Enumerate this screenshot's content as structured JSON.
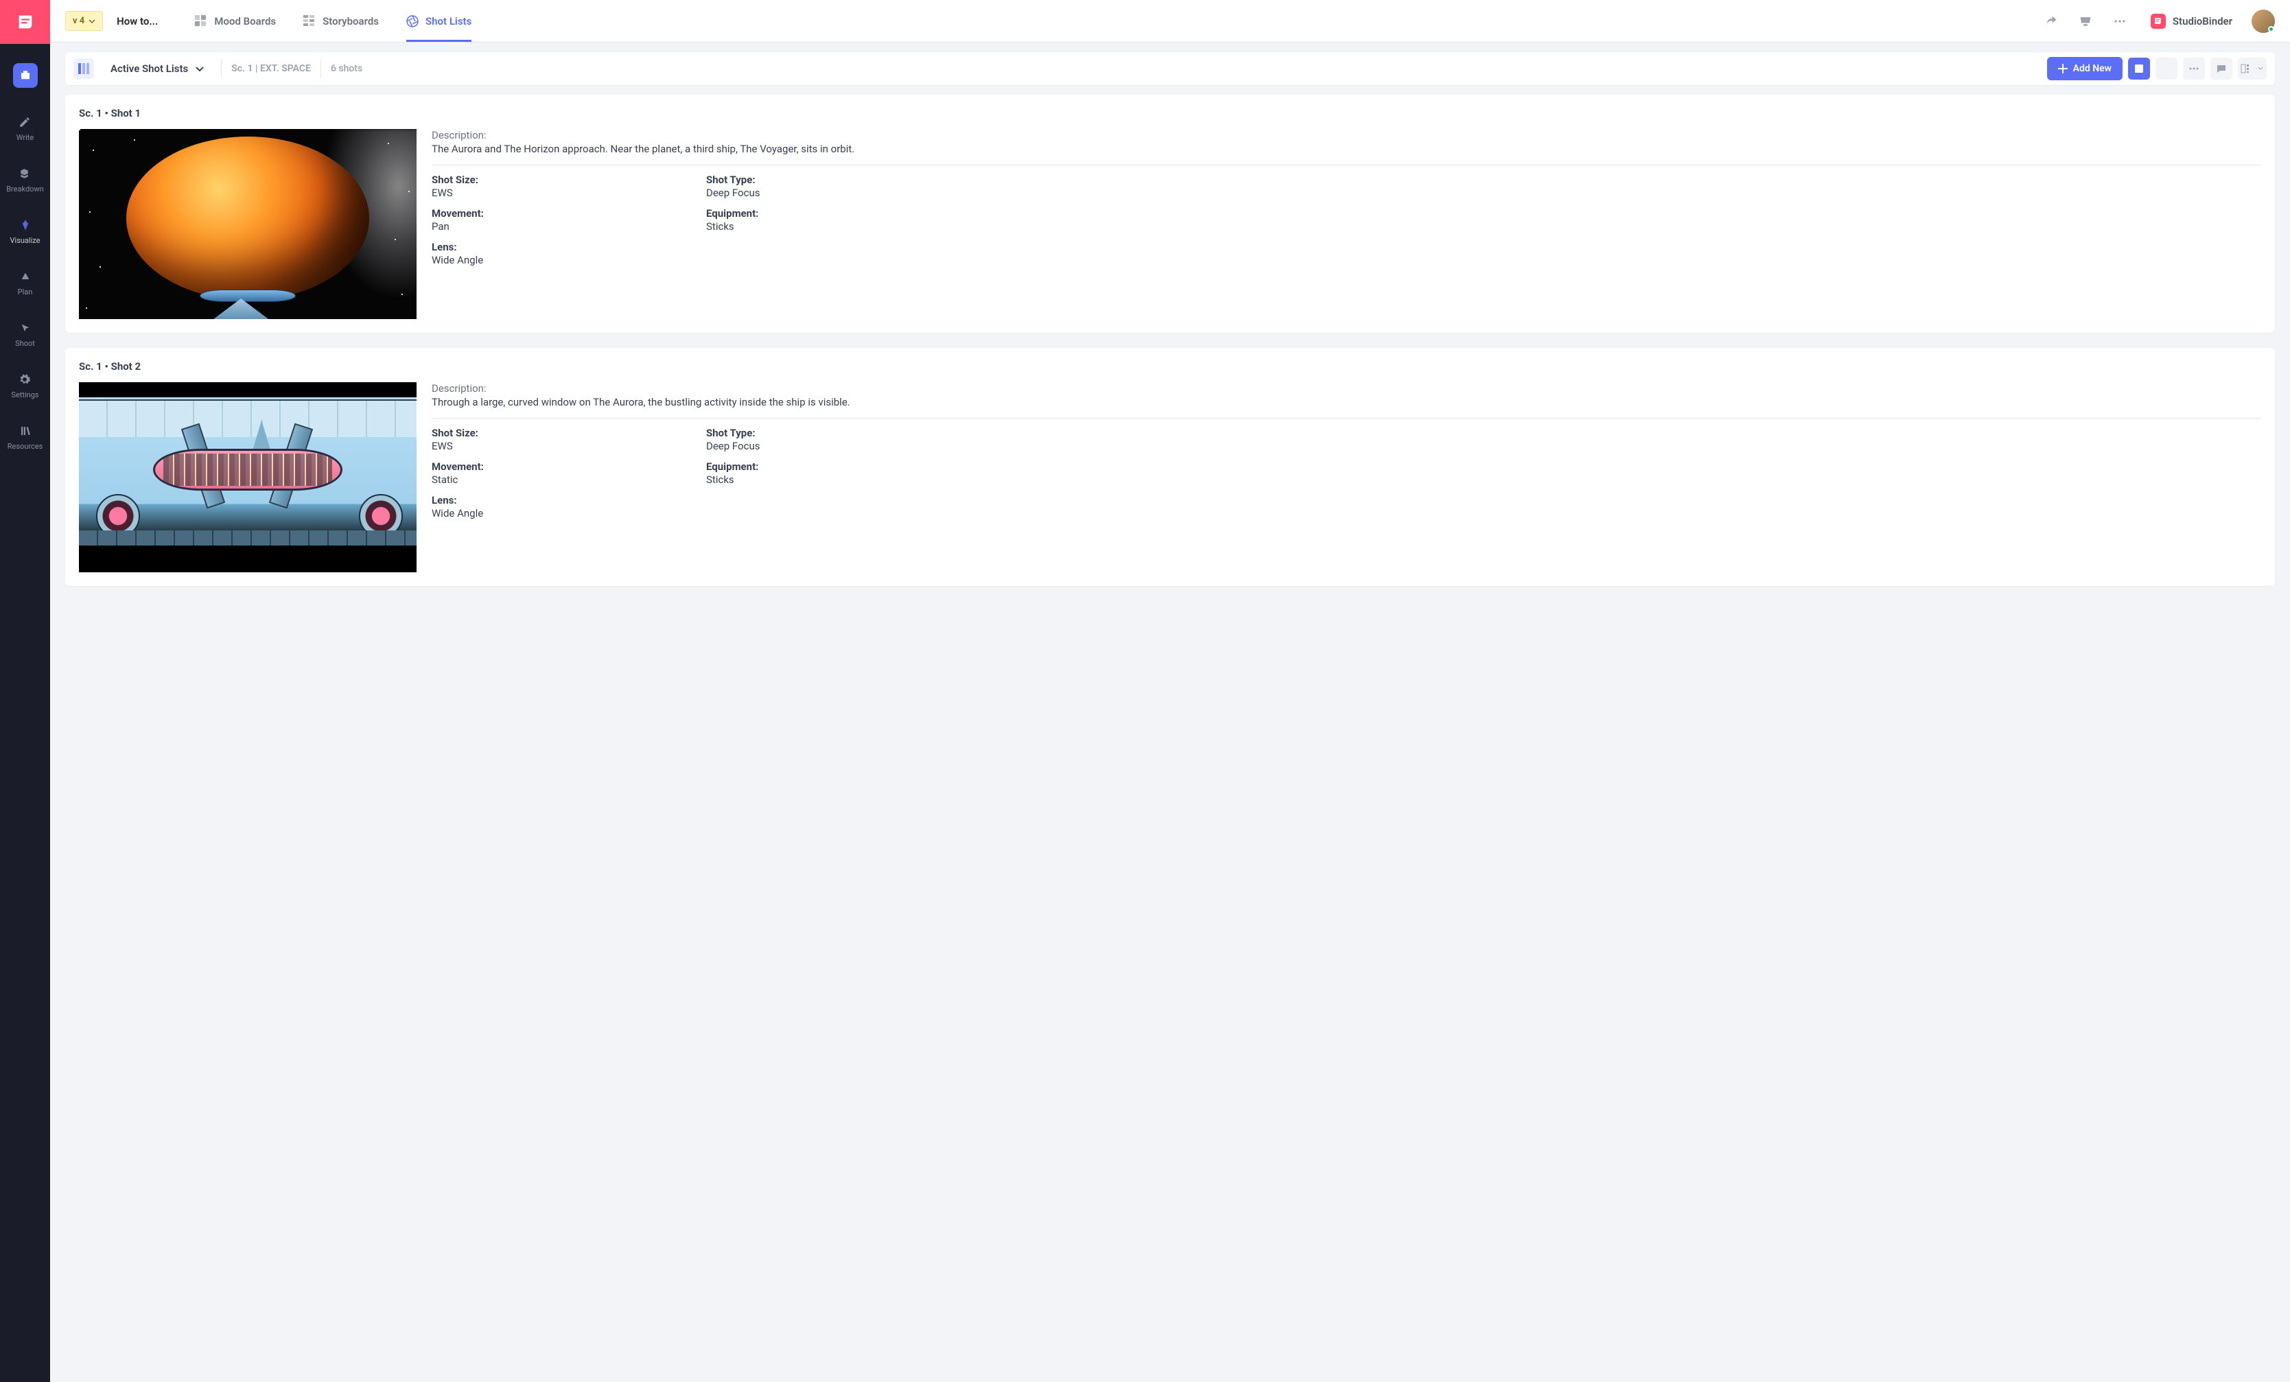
{
  "sidebar": {
    "items": [
      {
        "label": "Write"
      },
      {
        "label": "Breakdown"
      },
      {
        "label": "Visualize"
      },
      {
        "label": "Plan"
      },
      {
        "label": "Shoot"
      },
      {
        "label": "Settings"
      },
      {
        "label": "Resources"
      }
    ]
  },
  "topbar": {
    "version": "v 4",
    "project_title": "How to...",
    "tabs": [
      {
        "label": "Mood Boards"
      },
      {
        "label": "Storyboards"
      },
      {
        "label": "Shot Lists"
      }
    ],
    "brand": "StudioBinder"
  },
  "subbar": {
    "active_lists_label": "Active Shot Lists",
    "scene_label": "Sc. 1 | EXT. SPACE",
    "shot_count": "6 shots",
    "add_new_label": "Add New"
  },
  "shots": [
    {
      "header": "Sc. 1  •  Shot  1",
      "description_label": "Description:",
      "description": "The Aurora and The Horizon approach. Near the planet, a third ship, The Voyager, sits in orbit.",
      "shot_size_label": "Shot Size:",
      "shot_size": "EWS",
      "shot_type_label": "Shot Type:",
      "shot_type": "Deep Focus",
      "movement_label": "Movement:",
      "movement": "Pan",
      "equipment_label": "Equipment:",
      "equipment": "Sticks",
      "lens_label": "Lens:",
      "lens": "Wide Angle"
    },
    {
      "header": "Sc. 1  •  Shot  2",
      "description_label": "Description:",
      "description": "Through a large, curved window on The Aurora, the bustling activity inside the ship is visible.",
      "shot_size_label": "Shot Size:",
      "shot_size": "EWS",
      "shot_type_label": "Shot Type:",
      "shot_type": "Deep Focus",
      "movement_label": "Movement:",
      "movement": "Static",
      "equipment_label": "Equipment:",
      "equipment": "Sticks",
      "lens_label": "Lens:",
      "lens": "Wide Angle"
    }
  ]
}
